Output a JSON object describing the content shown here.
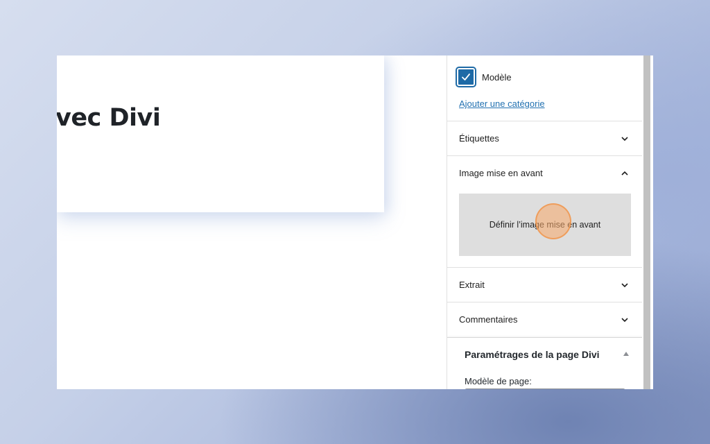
{
  "editor": {
    "post_title": "vec Divi"
  },
  "sidebar": {
    "category": {
      "label": "Modèle",
      "checked": true
    },
    "add_category_link": "Ajouter une catégorie",
    "panels": {
      "tags": {
        "title": "Étiquettes",
        "expanded": false
      },
      "featured_image": {
        "title": "Image mise en avant",
        "expanded": true,
        "button_label": "Définir l’image mise en avant"
      },
      "excerpt": {
        "title": "Extrait",
        "expanded": false
      },
      "comments": {
        "title": "Commentaires",
        "expanded": false
      }
    },
    "divi_settings": {
      "title": "Paramétrages de la page Divi",
      "template_label": "Modèle de page:"
    }
  },
  "colors": {
    "accent": "#1e6aa6",
    "link": "#2271b1",
    "cursor_highlight": "#f7a867"
  },
  "icons": {
    "checkbox": "check-icon",
    "collapsed": "chevron-down-icon",
    "expanded": "chevron-up-icon",
    "divi_toggle": "triangle-up-icon"
  }
}
